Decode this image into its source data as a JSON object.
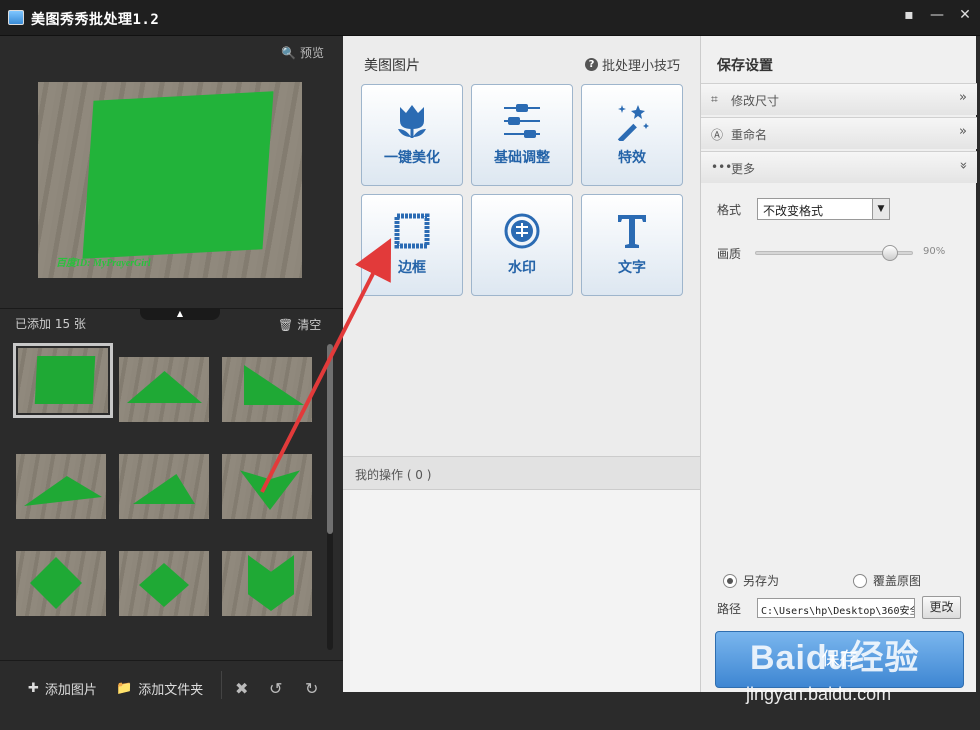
{
  "window": {
    "title": "美图秀秀批处理1.2"
  },
  "left": {
    "preview_label": "预览",
    "watermark": "百度ID: MyPrayerGirl",
    "added_count": "已添加 15 张",
    "clear_label": "清空",
    "add_image_label": "添加图片",
    "add_folder_label": "添加文件夹"
  },
  "middle": {
    "title": "美图图片",
    "tips_label": "批处理小技巧",
    "tools": [
      {
        "label": "一键美化",
        "icon": "tulip-icon"
      },
      {
        "label": "基础调整",
        "icon": "sliders-icon"
      },
      {
        "label": "特效",
        "icon": "magic-wand-icon"
      },
      {
        "label": "边框",
        "icon": "frame-icon"
      },
      {
        "label": "水印",
        "icon": "watermark-icon"
      },
      {
        "label": "文字",
        "icon": "text-icon"
      }
    ],
    "ops_label": "我的操作 ( 0 )"
  },
  "right": {
    "title": "保存设置",
    "sections": [
      {
        "label": "修改尺寸",
        "icon": "crop-icon",
        "chevron": "»"
      },
      {
        "label": "重命名",
        "icon": "rename-icon",
        "chevron": "»"
      },
      {
        "label": "更多",
        "icon": "more-icon",
        "chevron": "»"
      }
    ],
    "format_label": "格式",
    "format_value": "不改变格式",
    "quality_label": "画质",
    "quality_value": "90%",
    "quality_fraction": 0.9,
    "save_as_label": "另存为",
    "overwrite_label": "覆盖原图",
    "path_label": "路径",
    "path_value": "C:\\Users\\hp\\Desktop\\360安全",
    "change_label": "更改",
    "save_label": "保存"
  },
  "branding": {
    "logo": "Baidu经验",
    "url": "jingyan.baidu.com"
  },
  "colors": {
    "accent": "#2463a8",
    "green": "#22b33a",
    "arrow": "#e23a3a"
  }
}
